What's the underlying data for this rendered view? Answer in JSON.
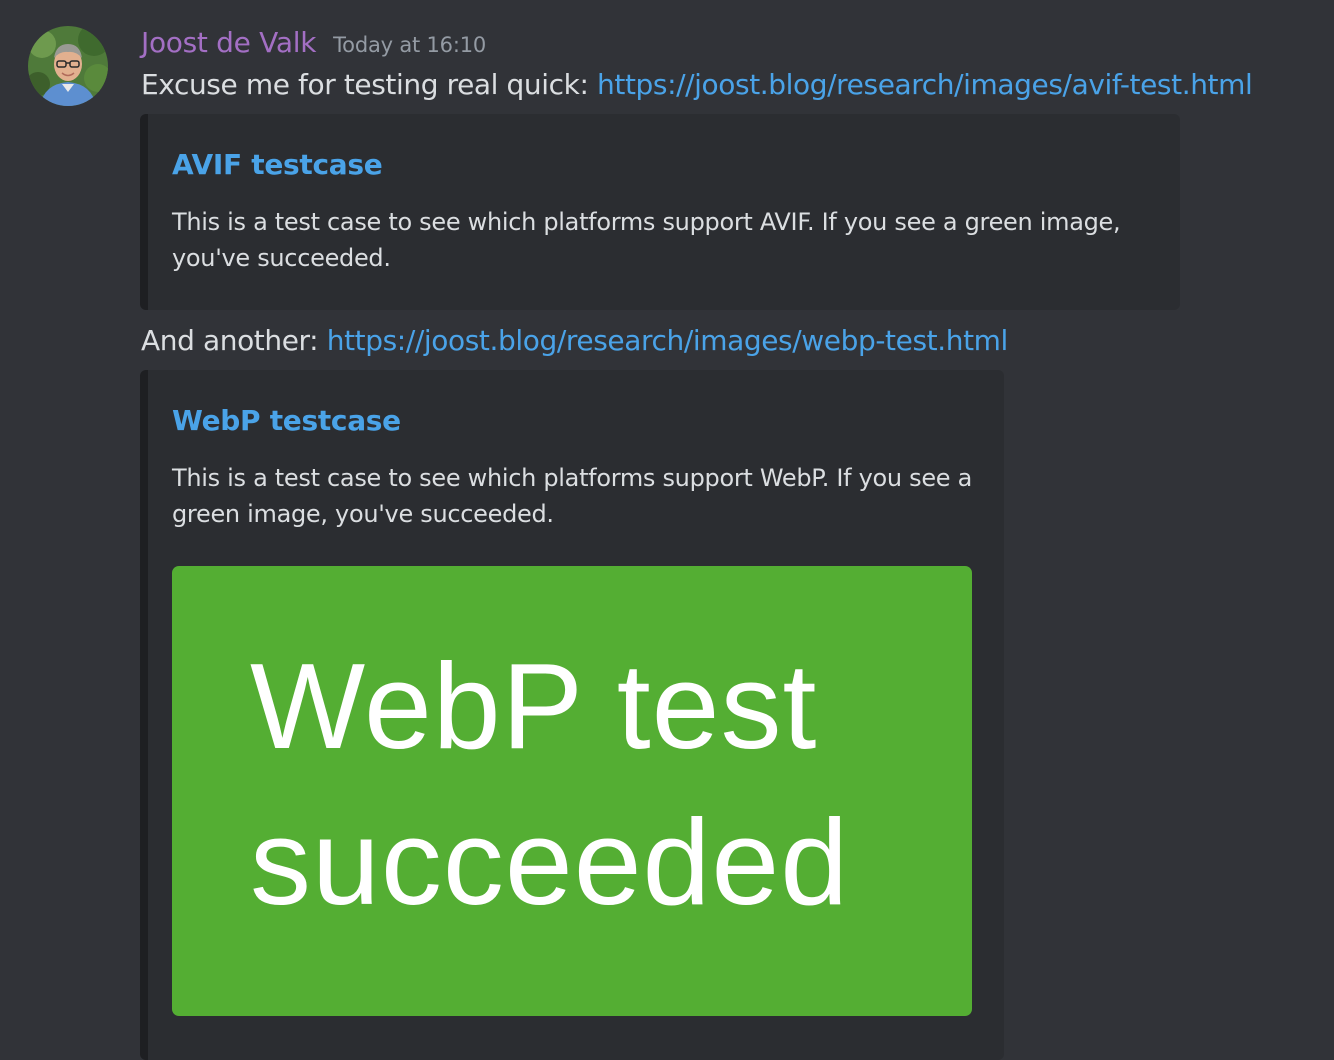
{
  "message": {
    "author": "Joost de Valk",
    "timestamp": "Today at 16:10",
    "line1": {
      "text": "Excuse me for testing real quick: ",
      "link": "https://joost.blog/research/images/avif-test.html"
    },
    "embed1": {
      "title": "AVIF testcase",
      "description": "This is a test case to see which platforms support AVIF. If you see a green image, you've succeeded."
    },
    "line2": {
      "text": "And another: ",
      "link": "https://joost.blog/research/images/webp-test.html"
    },
    "embed2": {
      "title": "WebP testcase",
      "description": "This is a test case to see which platforms support WebP. If you see a green image, you've succeeded.",
      "image": {
        "line1": "WebP test",
        "line2": "succeeded",
        "color": "#54ae33"
      }
    }
  },
  "colors": {
    "background": "#313338",
    "embed_background": "#2b2d31",
    "username": "#a36fc4",
    "link": "#4aa3e8",
    "text": "#dbdee1",
    "muted": "#949ba4"
  }
}
